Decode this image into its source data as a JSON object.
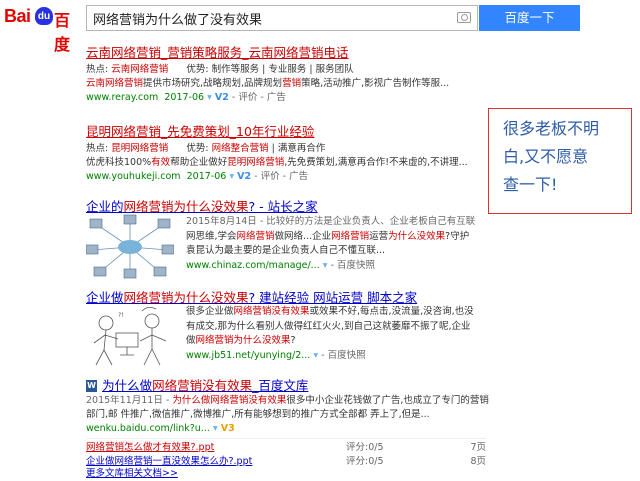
{
  "header": {
    "logo_bai": "Bai",
    "logo_du": "du",
    "logo_cn": "百度",
    "query": "网络营销为什么做了没有效果",
    "search_button": "百度一下"
  },
  "result1": {
    "title": "云南网络营销_营销策略服务_云南网络营销电话",
    "hotspot_label": "热点:",
    "hotspot_value": "云南网络营销",
    "adv_label": "优势:",
    "adv_value": "制作等服务 | 专业服务 | 服务团队",
    "snippet_a": "云南网络营销",
    "snippet_b": "提供市场研究,战略规划,品牌规划",
    "snippet_c": "营销",
    "snippet_d": "策略,活动推广,影视广告制作等服...",
    "url": "www.reray.com",
    "date": "2017-06",
    "v": "V2",
    "eval": "- 评价 - 广告"
  },
  "result2": {
    "title": "昆明网络营销_先免费策划_10年行业经验",
    "hotspot_label": "热点:",
    "hotspot_value": "昆明网络营销",
    "adv_label": "优势:",
    "adv_value_a": "网络整合营销",
    "adv_value_b": " | 满意再合作",
    "snippet_a": "优虎科技100%",
    "snippet_b": "有效",
    "snippet_c": "帮助企业做好",
    "snippet_d": "昆明网络营销",
    "snippet_e": ",先免费策划,满意再合作!不来虚的,不讲理...",
    "url": "www.youhukeji.com",
    "date": "2017-06",
    "v": "V2",
    "eval": "- 评价 - 广告"
  },
  "result3": {
    "title_a": "企业的",
    "title_b": "网络营销为什么没效果",
    "title_c": "? - 站长之家",
    "snip1": "2015年8月14日 - 比较好的方法是企业负责人、企业老板自己有互联",
    "snip2a": "网思维,学会",
    "snip2b": "网络营销",
    "snip2c": "做网络...企业",
    "snip2d": "网络营销",
    "snip2e": "运营",
    "snip2f": "为什么没效果",
    "snip2g": "?守护",
    "snip3": "袁昆认为最主要的是企业负责人自己不懂互联...",
    "url": "www.chinaz.com/manage/...",
    "cache": "- 百度快照"
  },
  "result4": {
    "title_a": "企业做",
    "title_b": "网络营销为什么没效果",
    "title_c": "? 建站经验 网站运营 脚本之家",
    "snip1a": "很多企业做",
    "snip1b": "网络营销没有效果",
    "snip1c": "或效果不好,每点击,没流量,没咨询,也没",
    "snip2": "有成交,那为什么看别人做得红红火火,到自己这就萎靡不振了呢,企业",
    "snip3a": "做",
    "snip3b": "网络营销为什么没效果",
    "snip3c": "?",
    "url": "www.jb51.net/yunying/2...",
    "cache": "- 百度快照"
  },
  "result5": {
    "title_a": "为什么做",
    "title_b": "网络营销没有效果",
    "title_c": "_百度文库",
    "snip1a": "2015年11月11日 - ",
    "snip1b": "为什么做网络营销没有效果",
    "snip1c": "很多中小企业花钱做了广告,也成立了专门的营销",
    "snip2": "部门,邮 件推广,微信推广,微博推广,所有能够想到的推广方式全部都 弄上了,但是...",
    "url": "wenku.baidu.com/link?u...",
    "v": "V3",
    "docs": [
      {
        "name": "网络营销怎么做才有效果?.ppt",
        "score": "评分:0/5",
        "pages": "7页"
      },
      {
        "name": "企业做网络营销一直没效果怎么办?.ppt",
        "score": "评分:0/5",
        "pages": "8页"
      }
    ],
    "more": "更多文库相关文档>>"
  },
  "annotation": {
    "line1": "很多老板不明",
    "line2": "白,又不愿意",
    "line3": "查一下!"
  }
}
